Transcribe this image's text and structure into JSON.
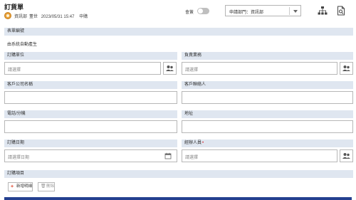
{
  "header": {
    "title": "訂貨單",
    "dept": "資訊部",
    "user": "董世",
    "datetime": "2023/05/31 15:47",
    "status": "申購",
    "toggle_label": "會簽",
    "dept_select": "申請部門：資訊部"
  },
  "form": {
    "form_no": {
      "label": "表單編號",
      "value": "由系統自動產生"
    },
    "order_unit": {
      "label": "訂購單位",
      "placeholder": "請選擇"
    },
    "sales_rep": {
      "label": "負責業務",
      "placeholder": "請選擇"
    },
    "customer_name": {
      "label": "客戶公司名稱"
    },
    "customer_contact": {
      "label": "客戶聯絡人"
    },
    "phone": {
      "label": "電話/分機"
    },
    "address": {
      "label": "地址"
    },
    "order_date": {
      "label": "訂購日期",
      "placeholder": "請選擇日期"
    },
    "handler": {
      "label": "經辦人員",
      "required_mark": "•",
      "placeholder": "請選擇"
    },
    "items": {
      "label": "訂購項目",
      "add_label": "新增明細",
      "delete_label": "刪除"
    }
  },
  "colors": {
    "label_bg": "#dfe6f0",
    "table_header": "#24408f",
    "required": "#d3202a",
    "add_icon": "#e0462d"
  },
  "icons": {
    "avatar": "user-avatar",
    "org": "org-chart-icon",
    "doc": "document-search-icon",
    "people": "people-icon",
    "calendar": "calendar-icon"
  }
}
